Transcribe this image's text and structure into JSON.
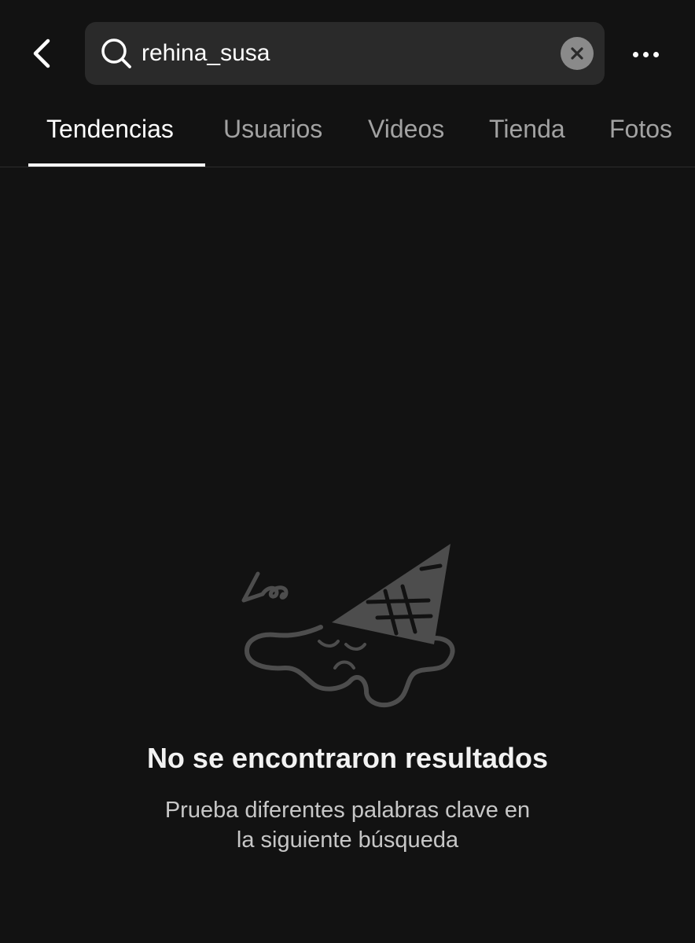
{
  "header": {
    "back_icon": "chevron-left-icon",
    "search": {
      "value": "rehina_susa",
      "icon": "search-icon",
      "clear_icon": "close-icon"
    },
    "more_icon": "more-horizontal-icon"
  },
  "tabs": [
    {
      "label": "Tendencias",
      "active": true
    },
    {
      "label": "Usuarios",
      "active": false
    },
    {
      "label": "Videos",
      "active": false
    },
    {
      "label": "Tienda",
      "active": false
    },
    {
      "label": "Fotos",
      "active": false
    }
  ],
  "empty_state": {
    "illustration": "melted-ice-cream-icon",
    "title": "No se encontraron resultados",
    "subtitle_line1": "Prueba diferentes palabras clave en",
    "subtitle_line2": "la siguiente búsqueda"
  },
  "colors": {
    "background": "#121212",
    "search_bg": "#2a2a2a",
    "tab_active": "#ffffff",
    "tab_inactive": "#a2a2a2",
    "illustration": "#4d4d4d"
  }
}
